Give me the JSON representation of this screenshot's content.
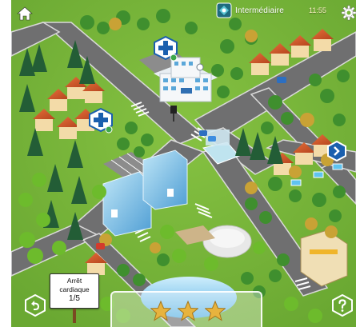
{
  "header": {
    "level_label": "Intermédiaire",
    "clock": "11:55"
  },
  "map": {
    "hospital_sign": "",
    "case_card": {
      "title_line1": "Arrêt",
      "title_line2": "cardiaque",
      "progress": "1/5"
    }
  },
  "stars": {
    "earned": 3,
    "total": 3
  },
  "icons": {
    "home": "home-icon",
    "settings": "gear-icon",
    "next": "chevron-right-icon",
    "back": "undo-arrow-icon",
    "help": "question-mark-icon",
    "medical": "medical-cross-icon"
  },
  "colors": {
    "grass": "#79b83c",
    "road": "#6f6f70",
    "badge_blue": "#1a5fae",
    "star_gold": "#e7b33e"
  }
}
